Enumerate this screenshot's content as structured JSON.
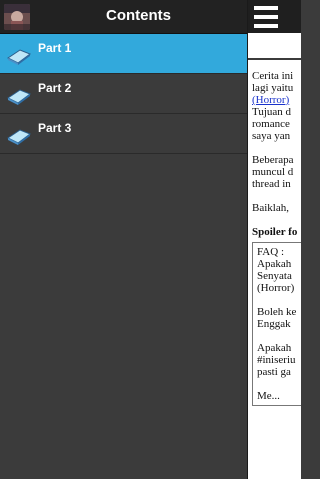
{
  "drawer": {
    "title": "Contents",
    "avatar_icon": "book-cover-thumbnail",
    "items": [
      {
        "label": "Part 1",
        "icon": "book-icon",
        "active": true
      },
      {
        "label": "Part 2",
        "icon": "book-icon",
        "active": false
      },
      {
        "label": "Part 3",
        "icon": "book-icon",
        "active": false
      }
    ]
  },
  "topbar": {
    "menu_icon": "hamburger-menu-icon"
  },
  "article": {
    "p1": [
      "Cerita ini",
      "lagi yaitu",
      "(Horror)",
      "Tujuan d",
      "romance",
      "saya yan"
    ],
    "p2": [
      "Beberapa",
      "muncul d",
      "thread in"
    ],
    "p3": [
      "Baiklah,"
    ],
    "spoiler_label": "Spoiler fo",
    "spoiler_lines": [
      "FAQ :",
      "Apakah",
      "Senyata",
      "(Horror)",
      "",
      "Boleh ke",
      "Enggak",
      "",
      "Apakah",
      "#iniseriu",
      "pasti ga",
      "",
      "Me..."
    ]
  },
  "colors": {
    "active": "#32a9dc",
    "drawer_bg": "#3b3b3b",
    "header_bg": "#222222"
  }
}
